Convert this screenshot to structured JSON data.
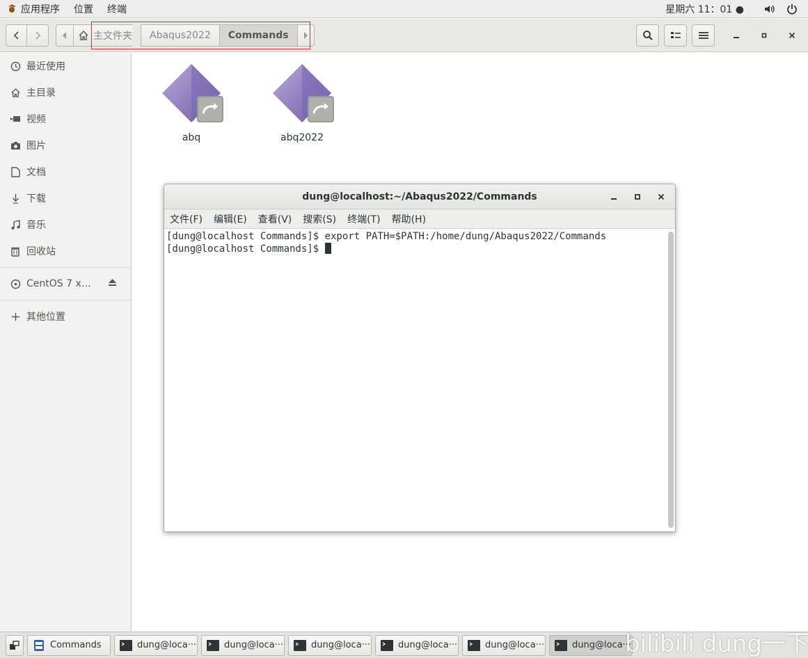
{
  "topbar": {
    "menus": [
      "应用程序",
      "位置",
      "终端"
    ],
    "clock": "星期六 11：01 ●"
  },
  "header": {
    "breadcrumbs": [
      "主文件夹",
      "Abaqus2022",
      "Commands"
    ]
  },
  "sidebar": {
    "items": [
      "最近使用",
      "主目录",
      "视频",
      "图片",
      "文档",
      "下载",
      "音乐",
      "回收站"
    ],
    "device": "CentOS 7 x…",
    "other": "其他位置"
  },
  "files": [
    {
      "name": "abq"
    },
    {
      "name": "abq2022"
    }
  ],
  "terminal": {
    "title": "dung@localhost:~/Abaqus2022/Commands",
    "menu": [
      "文件(F)",
      "编辑(E)",
      "查看(V)",
      "搜索(S)",
      "终端(T)",
      "帮助(H)"
    ],
    "lines": [
      "[dung@localhost Commands]$ export PATH=$PATH:/home/dung/Abaqus2022/Commands",
      "[dung@localhost Commands]$ "
    ]
  },
  "taskbar": {
    "items": [
      "Commands",
      "dung@loca···",
      "dung@loca···",
      "dung@loca···",
      "dung@loca···",
      "dung@loca···",
      "dung@loca···"
    ]
  },
  "watermark": "bilibili dung一下"
}
